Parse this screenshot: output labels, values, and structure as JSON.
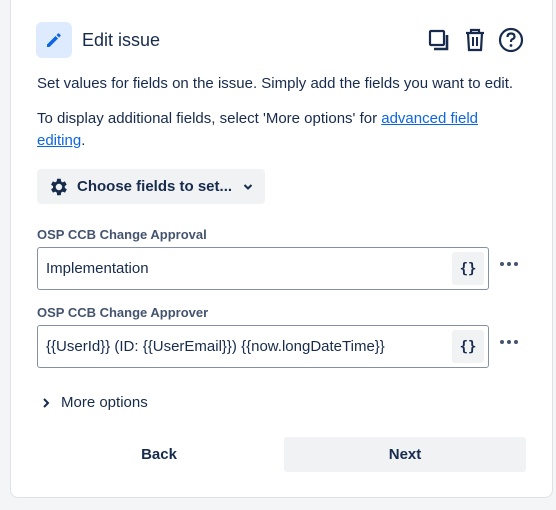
{
  "header": {
    "title": "Edit issue",
    "icons": [
      "pencil-icon",
      "duplicate-icon",
      "trash-icon",
      "help-icon"
    ]
  },
  "description": {
    "line1": "Set values for fields on the issue. Simply add the fields you want to edit.",
    "line2_prefix": "To display additional fields, select 'More options' for ",
    "line2_link": "advanced field editing",
    "line2_suffix": "."
  },
  "choose_fields": {
    "label": "Choose fields to set..."
  },
  "fields": [
    {
      "label": "OSP CCB Change Approval",
      "value": "Implementation",
      "smart_value_label": "{}"
    },
    {
      "label": "OSP CCB Change Approver",
      "value": "{{UserId}}  (ID: {{UserEmail}})  {{now.longDateTime}}",
      "smart_value_label": "{}"
    }
  ],
  "more_options": {
    "label": "More options"
  },
  "footer": {
    "back_label": "Back",
    "next_label": "Next"
  },
  "colors": {
    "accent": "#0c66e4",
    "icon_bg": "#deebff",
    "button_bg": "#f1f2f4",
    "text": "#172b4d"
  }
}
